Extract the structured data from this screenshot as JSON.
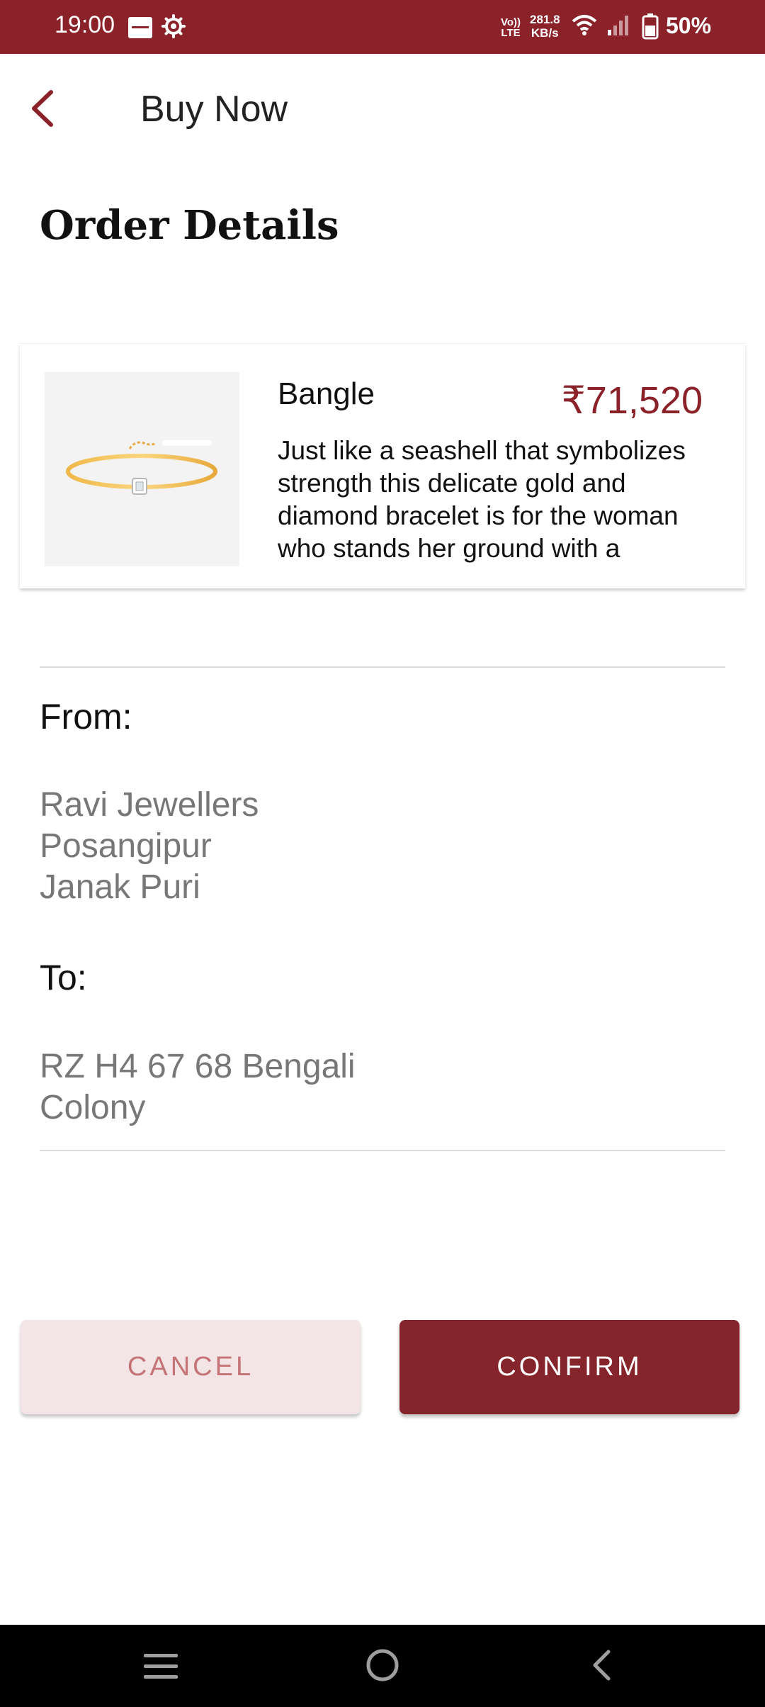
{
  "status_bar": {
    "time": "19:00",
    "volte_line1": "Vo))",
    "volte_line2": "LTE",
    "net_speed_value": "281.8",
    "net_speed_unit": "KB/s",
    "battery": "50%",
    "icons": [
      "zomato-icon",
      "settings-icon",
      "volte-icon",
      "wifi-icon",
      "signal-icon",
      "battery-icon"
    ]
  },
  "header": {
    "title": "Buy Now",
    "back_icon": "chevron-left-icon"
  },
  "section_title": "Order Details",
  "product": {
    "name": "Bangle",
    "price": "₹71,520",
    "description": "Just like a seashell that symbolizes strength this delicate gold and diamond bracelet is for the woman who stands her ground with a"
  },
  "from": {
    "label": "From:",
    "lines": [
      "Ravi Jewellers",
      "Posangipur",
      "Janak Puri"
    ]
  },
  "to": {
    "label": "To:",
    "lines": [
      "RZ H4 67 68 Bengali",
      "Colony"
    ]
  },
  "actions": {
    "cancel": "CANCEL",
    "confirm": "CONFIRM"
  },
  "colors": {
    "brand": "#8b2129",
    "confirm_bg": "#85252b",
    "cancel_bg": "#f3e5e6",
    "cancel_text": "#c47376"
  },
  "nav_bar": {
    "icons": [
      "menu-icon",
      "home-icon",
      "back-icon"
    ]
  }
}
